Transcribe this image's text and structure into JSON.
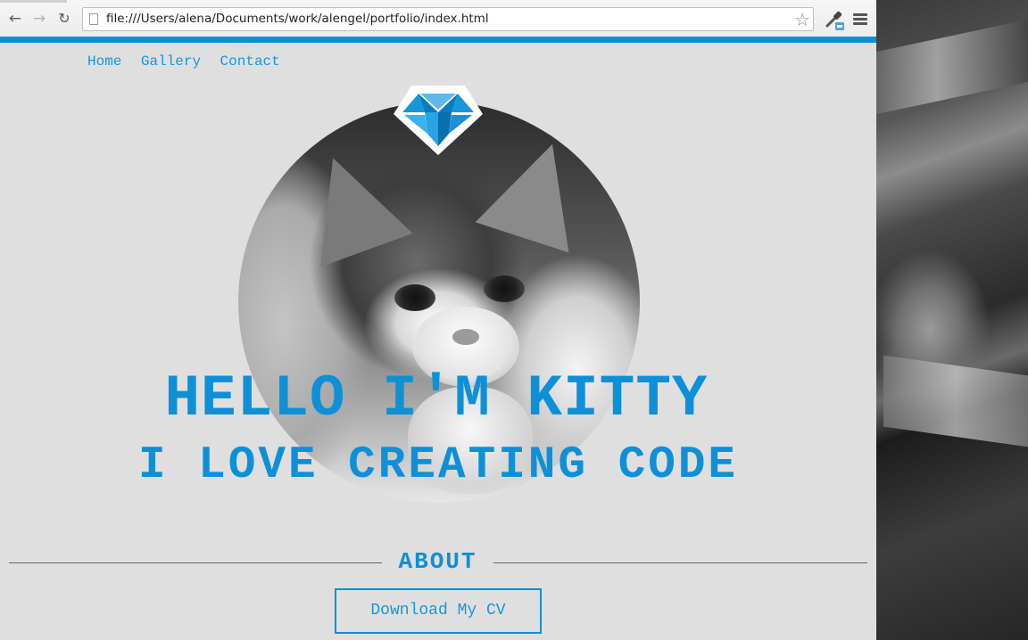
{
  "browser": {
    "url": "file:///Users/alena/Documents/work/alengel/portfolio/index.html",
    "back_icon": "←",
    "forward_icon": "→",
    "reload_icon": "↻",
    "star_icon": "☆",
    "accent_color": "#0e90d8"
  },
  "nav": {
    "items": [
      "Home",
      "Gallery",
      "Contact"
    ]
  },
  "hero": {
    "title": "HELLO I'M KITTY",
    "subtitle": "I LOVE CREATING CODE"
  },
  "about": {
    "heading": "ABOUT",
    "button_label": "Download My CV"
  },
  "colors": {
    "brand_blue": "#0e90d8",
    "page_background": "#dfdfdf"
  }
}
